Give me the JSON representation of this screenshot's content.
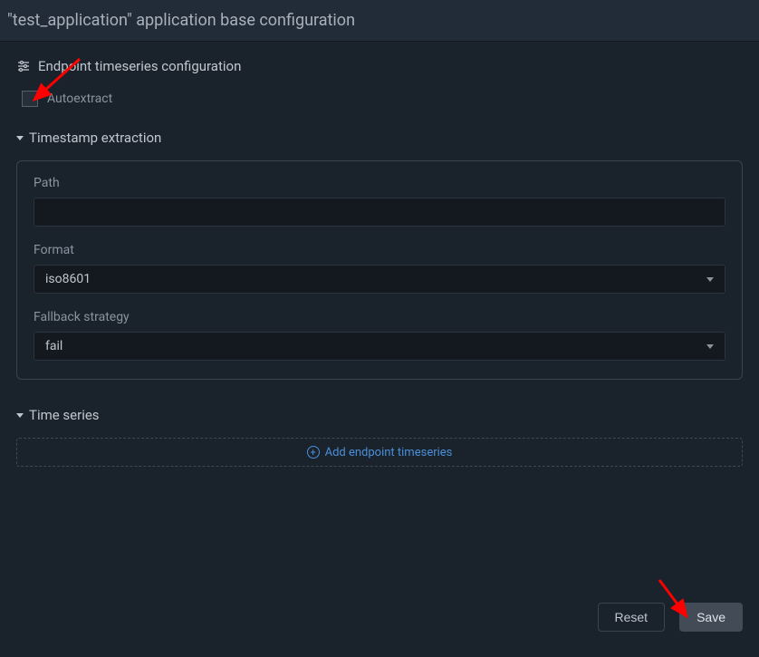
{
  "header": {
    "title": "\"test_application\" application base configuration"
  },
  "section": {
    "label": "Endpoint timeseries configuration"
  },
  "autoextract": {
    "label": "Autoextract",
    "checked": false
  },
  "timestamp": {
    "header": "Timestamp extraction",
    "path": {
      "label": "Path",
      "value": ""
    },
    "format": {
      "label": "Format",
      "value": "iso8601"
    },
    "fallback": {
      "label": "Fallback strategy",
      "value": "fail"
    }
  },
  "timeseries": {
    "header": "Time series",
    "add_label": "Add endpoint timeseries"
  },
  "footer": {
    "reset_label": "Reset",
    "save_label": "Save"
  },
  "colors": {
    "accent": "#4a90d9",
    "bg": "#1a222c",
    "panel_bg": "#222c38",
    "input_bg": "#14191f",
    "border": "#3a4450",
    "text": "#c0c6cd",
    "muted": "#8a939e",
    "arrow": "#ff0000"
  }
}
